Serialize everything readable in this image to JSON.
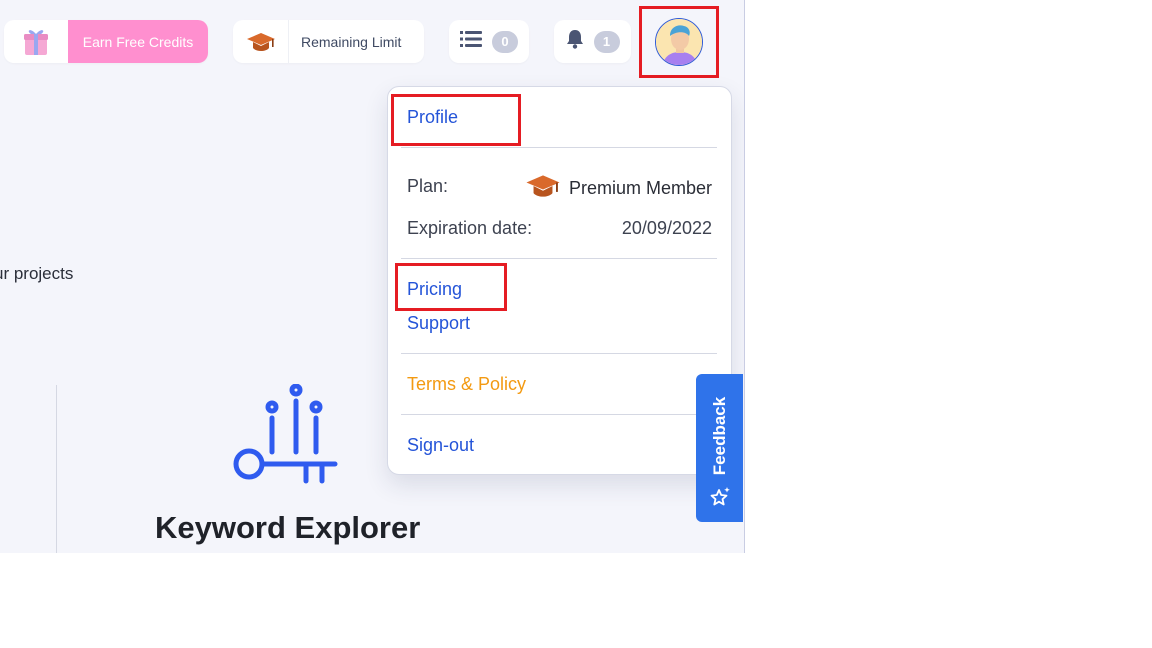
{
  "topbar": {
    "earn_credits_label": "Earn Free Credits",
    "remaining_limit_label": "Remaining Limit",
    "tasks_count": "0",
    "notifications_count": "1"
  },
  "main": {
    "projects_text": "ur projects",
    "tool_title": "Keyword Explorer"
  },
  "menu": {
    "profile": "Profile",
    "plan_label": "Plan:",
    "plan_value": "Premium Member",
    "expiration_label": "Expiration date:",
    "expiration_value": "20/09/2022",
    "pricing": "Pricing",
    "support": "Support",
    "terms": "Terms & Policy",
    "signout": "Sign-out"
  },
  "feedback": {
    "label": "Feedback"
  },
  "colors": {
    "accent_blue": "#2454d8",
    "earn_pink": "#ff8fcf",
    "terms_orange": "#f39a12",
    "highlight_red": "#e51c23",
    "feedback_blue": "#2f73ea"
  },
  "icons": [
    "gift-icon",
    "graduation-cap-icon",
    "list-icon",
    "bell-icon",
    "avatar",
    "keyword-key-icon",
    "star-sparkle-icon"
  ]
}
